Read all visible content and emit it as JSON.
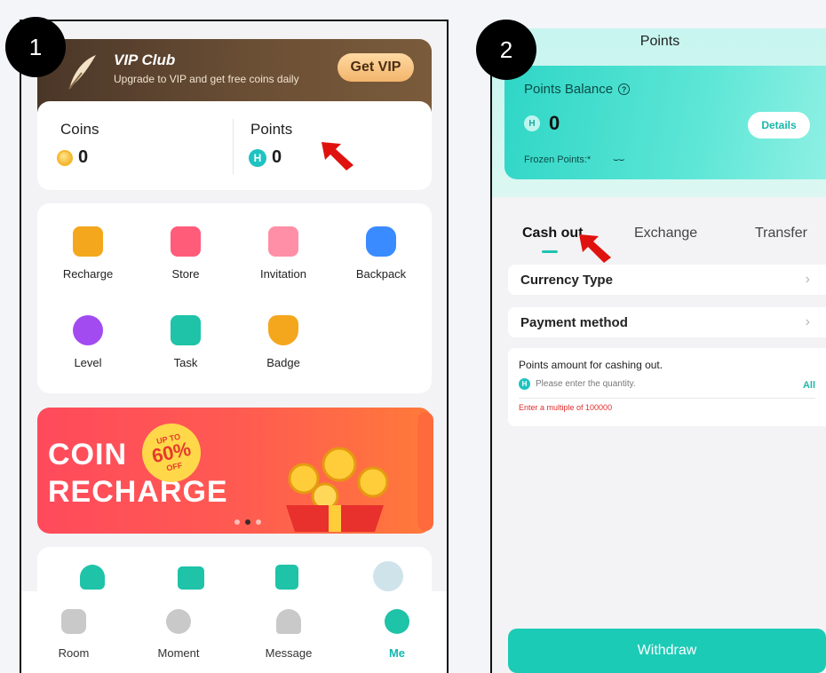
{
  "steps": [
    "1",
    "2"
  ],
  "phone1": {
    "vip": {
      "title": "VIP Club",
      "subtitle": "Upgrade to VIP and get free coins daily",
      "button": "Get VIP"
    },
    "wallet": {
      "coins_label": "Coins",
      "coins_value": "0",
      "points_label": "Points",
      "points_value": "0"
    },
    "grid": [
      {
        "label": "Recharge",
        "icon": "wallet-icon",
        "color": "#f4a71d"
      },
      {
        "label": "Store",
        "icon": "store-icon",
        "color": "#ff5c7a"
      },
      {
        "label": "Invitation",
        "icon": "envelope-heart-icon",
        "color": "#ff6f8a"
      },
      {
        "label": "Backpack",
        "icon": "backpack-icon",
        "color": "#3a8bff"
      },
      {
        "label": "Level",
        "icon": "level-star-icon",
        "color": "#a24bf0"
      },
      {
        "label": "Task",
        "icon": "task-calendar-icon",
        "color": "#1ec3a8"
      },
      {
        "label": "Badge",
        "icon": "badge-crown-icon",
        "color": "#f4a71d"
      }
    ],
    "banner": {
      "line1": "COIN",
      "line2": "RECHARGE",
      "badge_top": "UP TO",
      "badge_pct": "60%",
      "badge_bottom": "OFF"
    },
    "tabbar": [
      {
        "label": "Room",
        "icon": "room-icon"
      },
      {
        "label": "Moment",
        "icon": "planet-icon"
      },
      {
        "label": "Message",
        "icon": "bell-icon"
      },
      {
        "label": "Me",
        "icon": "me-icon",
        "active": true
      }
    ]
  },
  "phone2": {
    "title": "Points",
    "balance_label": "Points Balance",
    "balance_value": "0",
    "details_button": "Details",
    "frozen_label": "Frozen Points:*",
    "tabs": [
      "Cash out",
      "Exchange",
      "Transfer"
    ],
    "active_tab": "Cash out",
    "rows": [
      "Currency Type",
      "Payment method"
    ],
    "amount": {
      "heading": "Points amount for cashing out.",
      "placeholder": "Please enter the quantity.",
      "all": "All",
      "warning": "Enter a multiple of 100000"
    },
    "withdraw_button": "Withdraw"
  },
  "colors": {
    "accent": "#1ccbb6",
    "arrow": "#e0120f",
    "warning": "#e02c2c"
  }
}
